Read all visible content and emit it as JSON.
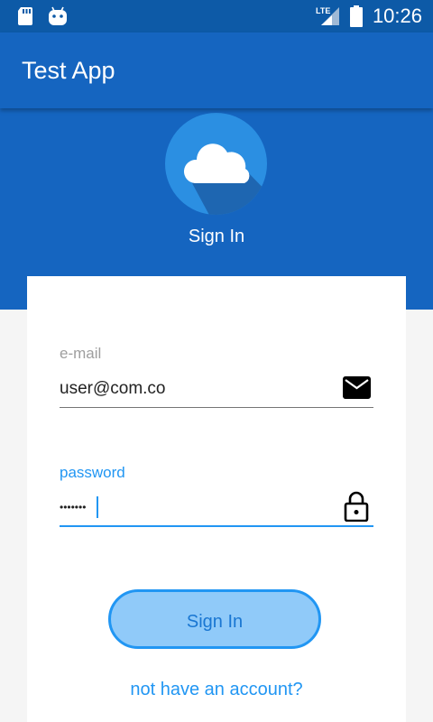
{
  "status_bar": {
    "time": "10:26",
    "network_label": "LTE",
    "left_icons": [
      "sd-card-icon",
      "android-icon"
    ],
    "right_icons": [
      "lte-signal-icon",
      "battery-icon"
    ]
  },
  "app_bar": {
    "title": "Test App"
  },
  "header": {
    "logo_icon": "cloud-icon",
    "title": "Sign In"
  },
  "form": {
    "email": {
      "label": "e-mail",
      "value": "user@com.co",
      "icon": "mail-icon"
    },
    "password": {
      "label": "password",
      "masked_value": "•••••••",
      "icon": "lock-icon"
    },
    "submit_label": "Sign In",
    "account_link": "not have an account?"
  },
  "colors": {
    "status_bar": "#0d5aa7",
    "primary": "#1565c0",
    "accent": "#2196f3",
    "button_fill": "#90caf9",
    "background": "#f5f5f5"
  }
}
